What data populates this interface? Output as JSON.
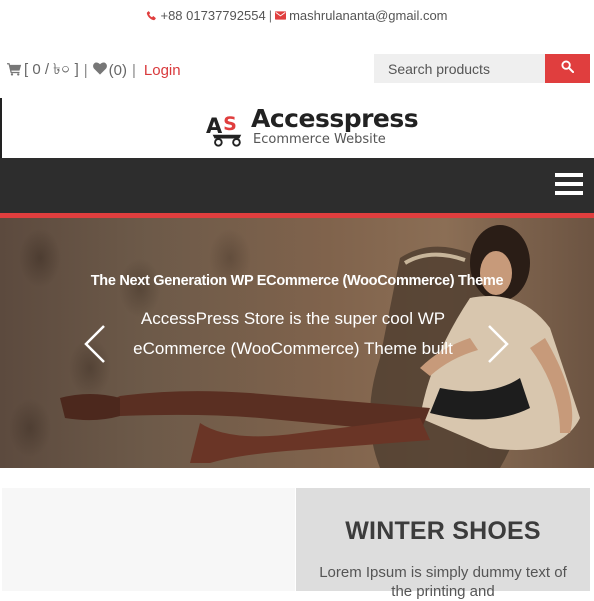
{
  "topbar": {
    "phone": "+88 01737792554",
    "separator": "|",
    "email": "mashrulananta@gmail.com"
  },
  "header": {
    "cart_text": "[ 0 / ৳০ ]",
    "pipe": "|",
    "wishlist_text": "(0)",
    "login_label": "Login",
    "search_placeholder": "Search products"
  },
  "logo": {
    "mark": "AS",
    "title": "Accesspress",
    "subtitle": "Ecommerce Website"
  },
  "hero": {
    "heading": "The Next Generation WP ECommerce (WooCommerce) Theme",
    "text": "AccessPress Store is the super cool WP eCommerce (WooCommerce) Theme  built"
  },
  "promo": {
    "title": "WINTER SHOES",
    "text": "Lorem Ipsum is simply dummy text of the printing and"
  },
  "colors": {
    "accent": "#e03e3e",
    "nav_bg": "#2d2d2d",
    "promo_bg": "#dddddd"
  },
  "icons": [
    "phone-icon",
    "email-icon",
    "cart-icon",
    "heart-icon",
    "search-icon",
    "menu-icon",
    "chevron-left-icon",
    "chevron-right-icon"
  ]
}
